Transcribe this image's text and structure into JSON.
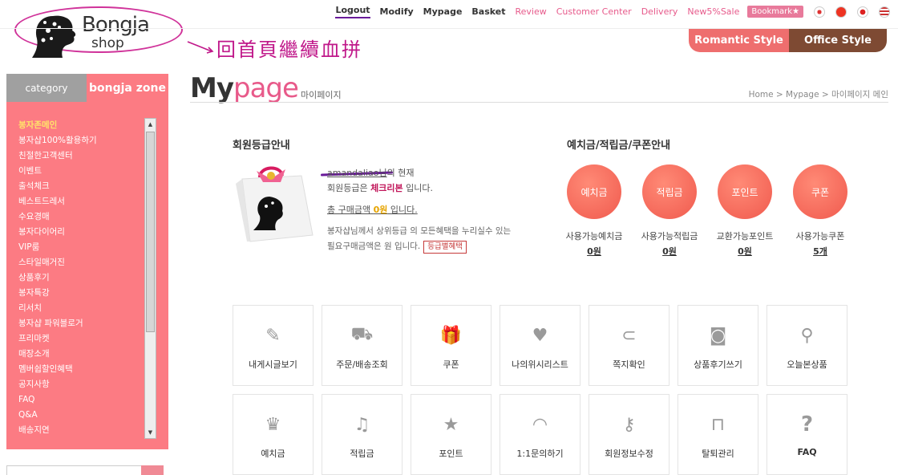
{
  "logo": {
    "line1": "Bongja",
    "line2": "shop"
  },
  "annotation": {
    "text": "回首頁繼續血拼"
  },
  "topnav": {
    "items": [
      {
        "label": "Logout",
        "style": "active"
      },
      {
        "label": "Modify",
        "style": "dark"
      },
      {
        "label": "Mypage",
        "style": "dark"
      },
      {
        "label": "Basket",
        "style": "dark"
      },
      {
        "label": "Review",
        "style": "pink"
      },
      {
        "label": "Customer Center",
        "style": "pink"
      },
      {
        "label": "Delivery",
        "style": "pink"
      },
      {
        "label": "New5%Sale",
        "style": "pink"
      }
    ],
    "bookmark": "Bookmark★"
  },
  "style_tabs": {
    "romantic": "Romantic Style",
    "office": "Office Style"
  },
  "sidebar": {
    "tab_category": "category",
    "tab_zone": "bongja zone",
    "items": [
      "봉자존메인",
      "봉자샵100%활용하기",
      "친절한고객센터",
      "이벤트",
      "출석체크",
      "베스트드레서",
      "수요경매",
      "봉자다이어리",
      "VIP룸",
      "스타일매거진",
      "상품후기",
      "봉자특강",
      "리서치",
      "봉자샵 파워블로거",
      "프리마켓",
      "매장소개",
      "멤버쉽할인혜택",
      "공지사항",
      "FAQ",
      "Q&A",
      "배송지연"
    ]
  },
  "page": {
    "title_my": "My",
    "title_page": "page",
    "subtitle": "마이페이지",
    "breadcrumb": "Home > Mypage > 마이페이지 메인"
  },
  "grade": {
    "heading": "회원등급안내",
    "username": "amandaliao님",
    "suffix": "의 현재",
    "grade_prefix": "회원등급은 ",
    "grade_name": "체크리본",
    "grade_suffix": " 입니다.",
    "total_prefix": "총 구매금액 ",
    "total_value": "0원",
    "total_suffix": " 입니다.",
    "desc1": "봉자샵님께서 상위등급 의 모든혜택을 누리실수 있는",
    "desc2": "필요구매금액은 원 입니다.",
    "benefit_button": "등급별혜택"
  },
  "points": {
    "heading": "예치금/적립금/쿠폰안내",
    "items": [
      {
        "circle": "예치금",
        "label": "사용가능예치금",
        "value": "0원"
      },
      {
        "circle": "적립금",
        "label": "사용가능적립금",
        "value": "0원"
      },
      {
        "circle": "포인트",
        "label": "교환가능포인트",
        "value": "0원"
      },
      {
        "circle": "쿠폰",
        "label": "사용가능쿠폰",
        "value": "5개"
      }
    ]
  },
  "menu": {
    "row1": [
      {
        "label": "내게시글보기",
        "icon": "pencil-icon"
      },
      {
        "label": "주문/배송조회",
        "icon": "car-icon"
      },
      {
        "label": "쿠폰",
        "icon": "gift-icon"
      },
      {
        "label": "나의위시리스트",
        "icon": "heart-icon"
      },
      {
        "label": "쪽지확인",
        "icon": "paperclip-icon"
      },
      {
        "label": "상품후기쓰기",
        "icon": "camera-icon"
      },
      {
        "label": "오늘본상품",
        "icon": "magnifier-icon"
      }
    ],
    "row2": [
      {
        "label": "예치금",
        "icon": "crown-icon"
      },
      {
        "label": "적립금",
        "icon": "music-note-icon"
      },
      {
        "label": "포인트",
        "icon": "star-icon"
      },
      {
        "label": "1:1문의하기",
        "icon": "headphones-icon"
      },
      {
        "label": "회원정보수정",
        "icon": "key-icon"
      },
      {
        "label": "탈퇴관리",
        "icon": "unlock-icon"
      },
      {
        "label": "FAQ",
        "icon": "question-icon"
      }
    ]
  }
}
